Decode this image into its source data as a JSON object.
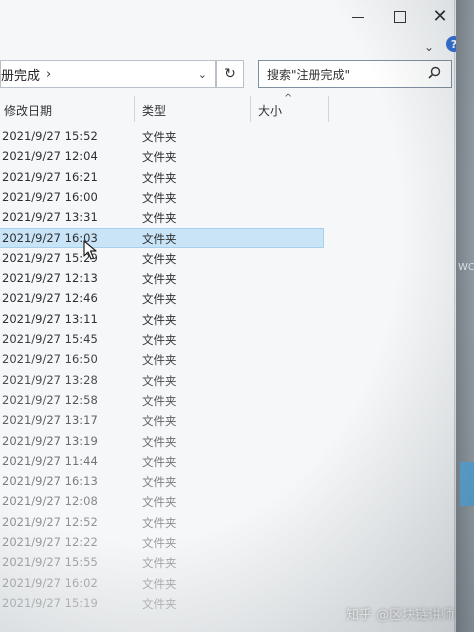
{
  "window": {
    "minimize_glyph": "–",
    "close_glyph": "✕",
    "help_glyph": "?",
    "ribbon_expand_glyph": "⌄"
  },
  "address_bar": {
    "path": "册完成",
    "separator": "›",
    "dropdown_glyph": "⌄",
    "refresh_glyph": "↻"
  },
  "search": {
    "value": "搜索\"注册完成\"",
    "icon": "search-icon"
  },
  "columns": {
    "date": "修改日期",
    "type": "类型",
    "size": "大小",
    "sort_glyph": "^"
  },
  "files": [
    {
      "date": "2021/9/27 15:52",
      "type": "文件夹"
    },
    {
      "date": "2021/9/27 12:04",
      "type": "文件夹"
    },
    {
      "date": "2021/9/27 16:21",
      "type": "文件夹"
    },
    {
      "date": "2021/9/27 16:00",
      "type": "文件夹"
    },
    {
      "date": "2021/9/27 13:31",
      "type": "文件夹"
    },
    {
      "date": "2021/9/27 16:03",
      "type": "文件夹"
    },
    {
      "date": "2021/9/27 15:29",
      "type": "文件夹"
    },
    {
      "date": "2021/9/27 12:13",
      "type": "文件夹"
    },
    {
      "date": "2021/9/27 12:46",
      "type": "文件夹"
    },
    {
      "date": "2021/9/27 13:11",
      "type": "文件夹"
    },
    {
      "date": "2021/9/27 15:45",
      "type": "文件夹"
    },
    {
      "date": "2021/9/27 16:50",
      "type": "文件夹"
    },
    {
      "date": "2021/9/27 13:28",
      "type": "文件夹"
    },
    {
      "date": "2021/9/27 12:58",
      "type": "文件夹"
    },
    {
      "date": "2021/9/27 13:17",
      "type": "文件夹"
    },
    {
      "date": "2021/9/27 13:19",
      "type": "文件夹"
    },
    {
      "date": "2021/9/27 11:44",
      "type": "文件夹"
    },
    {
      "date": "2021/9/27 16:13",
      "type": "文件夹"
    },
    {
      "date": "2021/9/27 12:08",
      "type": "文件夹"
    },
    {
      "date": "2021/9/27 12:52",
      "type": "文件夹"
    },
    {
      "date": "2021/9/27 12:22",
      "type": "文件夹"
    },
    {
      "date": "2021/9/27 15:55",
      "type": "文件夹"
    },
    {
      "date": "2021/9/27 16:02",
      "type": "文件夹"
    },
    {
      "date": "2021/9/27 15:19",
      "type": "文件夹"
    }
  ],
  "selected_index": 5,
  "side": {
    "right_label": "WC"
  },
  "watermark": "知乎 @区块链讲师",
  "colors": {
    "selection": "#c9e4f6",
    "accent": "#2f6fd1"
  }
}
